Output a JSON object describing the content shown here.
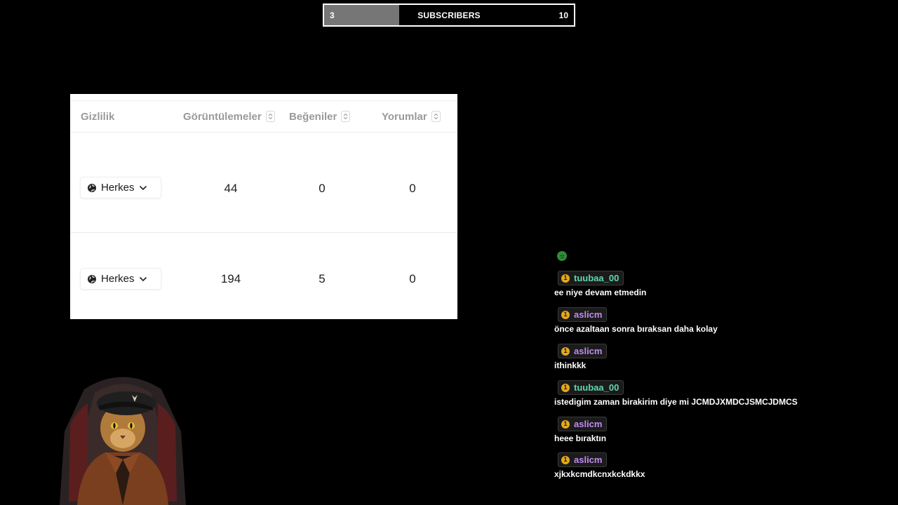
{
  "subscriber_goal": {
    "current": "3",
    "label": "SUBSCRIBERS",
    "target": "10",
    "progress_fraction": 0.3,
    "fill_color": "#767676",
    "border_color": "#ffffff"
  },
  "stats_table": {
    "headers": {
      "visibility": "Gizlilik",
      "views": "Görüntülemeler",
      "likes": "Beğeniler",
      "comments": "Yorumlar"
    },
    "sort_icon": "sort-updown-icon",
    "rows": [
      {
        "visibility": "Herkes",
        "views": "44",
        "likes": "0",
        "comments": "0"
      },
      {
        "visibility": "Herkes",
        "views": "194",
        "likes": "5",
        "comments": "0"
      }
    ],
    "visibility_icon": "globe-icon",
    "dropdown_icon": "chevron-down-icon"
  },
  "chat": {
    "top_emote": "emote-icon",
    "badge_icon": "coin-badge-icon",
    "messages": [
      {
        "user": "tuubaa_00",
        "color": "#5ed6b0",
        "text": "ee niye devam etmedin"
      },
      {
        "user": "aslicm",
        "color": "#c08bf0",
        "text": "önce azaltaan sonra bıraksan daha kolay"
      },
      {
        "user": "aslicm",
        "color": "#c08bf0",
        "text": "ithinkkk"
      },
      {
        "user": "tuubaa_00",
        "color": "#5ed6b0",
        "text": "istedigim zaman birakirim diye mi JCMDJXMDCJSMCJDMCS"
      },
      {
        "user": "aslicm",
        "color": "#c08bf0",
        "text": "heee bıraktın"
      },
      {
        "user": "aslicm",
        "color": "#c08bf0",
        "text": "xjkxkcmdkcnxkckdkkx"
      }
    ]
  },
  "avatar": {
    "icon": "cat-in-beret-avatar"
  }
}
